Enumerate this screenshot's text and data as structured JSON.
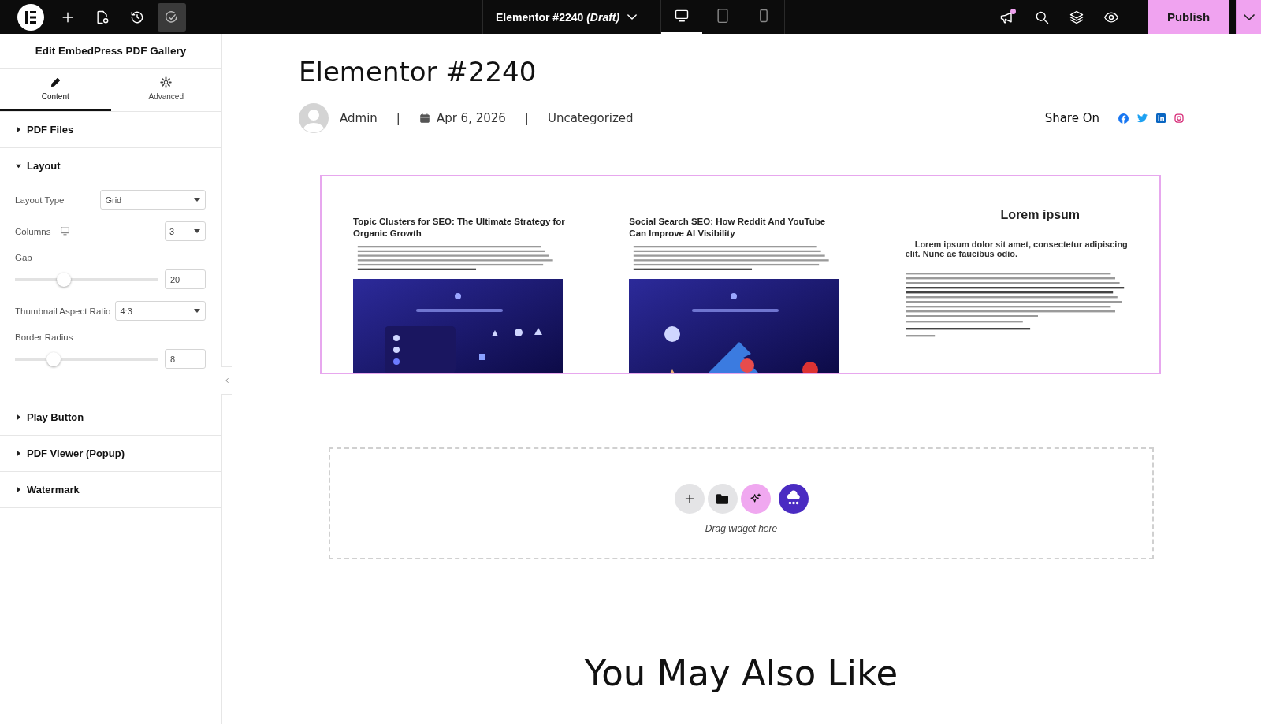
{
  "topbar": {
    "document_title": "Elementor #2240",
    "status": "(Draft)",
    "devices": [
      {
        "kind": "desktop",
        "selected": true
      },
      {
        "kind": "tablet",
        "selected": false
      },
      {
        "kind": "mobile",
        "selected": false
      }
    ],
    "notification": true,
    "publish": "Publish"
  },
  "panel": {
    "title": "Edit EmbedPress PDF Gallery",
    "tabs": [
      {
        "kind": "content",
        "label": "Content",
        "selected": true
      },
      {
        "kind": "advanced",
        "label": "Advanced",
        "selected": false
      }
    ],
    "sections": [
      {
        "title": "PDF Files",
        "expanded": false
      },
      {
        "title": "Layout",
        "expanded": true,
        "controls": [
          {
            "kind": "select",
            "label": "Layout Type",
            "value": "Grid"
          },
          {
            "kind": "responsive-select",
            "label": "Columns",
            "value": "3"
          },
          {
            "kind": "slider",
            "label": "Gap",
            "level": 0.34,
            "value": "20"
          },
          {
            "kind": "select",
            "label": "Thumbnail Aspect Ratio",
            "value": "4:3"
          },
          {
            "kind": "slider",
            "label": "Border Radius",
            "level": 0.27,
            "value": "8"
          }
        ]
      },
      {
        "title": "Play Button",
        "expanded": false
      },
      {
        "title": "PDF Viewer (Popup)",
        "expanded": false
      },
      {
        "title": "Watermark",
        "expanded": false
      }
    ]
  },
  "page": {
    "title": "Elementor #2240",
    "author": "Admin",
    "separator_1": "|",
    "date": "Apr 6, 2026",
    "separator_2": "|",
    "category": "Uncategorized",
    "share_label": "Share On",
    "gallery": [
      {
        "kind": "article",
        "title": "Topic Clusters for SEO: The Ultimate Strategy for Organic Growth"
      },
      {
        "kind": "article",
        "title": "Social Search SEO: How Reddit And YouTube Can Improve AI Visibility"
      },
      {
        "kind": "document",
        "heading": "Lorem ipsum",
        "subheading": "Lorem ipsum dolor sit amet, consectetur adipiscing elit. Nunc ac faucibus odio."
      }
    ],
    "drop_zone": {
      "hint": "Drag widget here"
    },
    "related_heading": "You May Also Like"
  }
}
